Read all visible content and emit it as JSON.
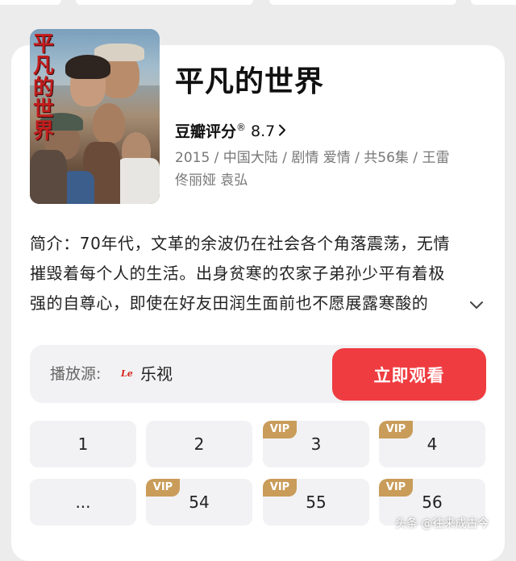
{
  "show": {
    "title": "平凡的世界",
    "poster_text": "平凡的世界",
    "rating_label": "豆瓣评分",
    "rating_mark": "®",
    "rating_value": "8.7",
    "meta_line1": "2015 / 中国大陆 / 剧情 爱情 / 共56集 / 王雷",
    "meta_line2": "佟丽娅 袁弘"
  },
  "intro": {
    "line1": "简介：70年代，文革的余波仍在社会各个角落震荡，无情",
    "line2": "摧毁着每个人的生活。出身贫寒的农家子弟孙少平有着极",
    "line3": "强的自尊心，即使在好友田润生面前也不愿展露寒酸的"
  },
  "source": {
    "label": "播放源:",
    "logo": "Le",
    "name": "乐视",
    "play_label": "立即观看"
  },
  "episodes": [
    {
      "label": "1",
      "vip": false
    },
    {
      "label": "2",
      "vip": false
    },
    {
      "label": "3",
      "vip": true
    },
    {
      "label": "4",
      "vip": true
    },
    {
      "label": "...",
      "vip": false
    },
    {
      "label": "54",
      "vip": true
    },
    {
      "label": "55",
      "vip": true
    },
    {
      "label": "56",
      "vip": true
    }
  ],
  "vip_label": "VIP",
  "watermark": "头条 @往来成古今",
  "colors": {
    "accent": "#ef3c40",
    "vip": "#c99c5a",
    "card_bg": "#ffffff",
    "page_bg": "#ececec",
    "source_bg": "#f2f2f4"
  },
  "icons": {
    "rating_chevron": "chevron-right-icon",
    "expand": "chevron-down-icon",
    "source_logo": "letv-logo"
  }
}
